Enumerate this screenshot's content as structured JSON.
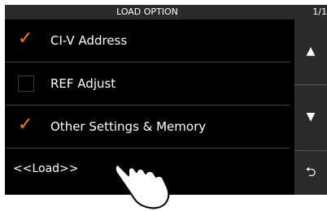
{
  "header": {
    "title": "LOAD OPTION",
    "page": "1/1"
  },
  "options": [
    {
      "label": "CI-V Address",
      "checked": true
    },
    {
      "label": "REF Adjust",
      "checked": false
    },
    {
      "label": "Other Settings & Memory",
      "checked": true
    }
  ],
  "check_glyph": "✓",
  "load_label": "<<Load>>",
  "buttons": {
    "up": {
      "glyph": "▲",
      "icon": "up-arrow-icon"
    },
    "down": {
      "glyph": "▼",
      "icon": "down-arrow-icon"
    },
    "back": {
      "glyph": "⮌",
      "icon": "return-icon"
    }
  },
  "colors": {
    "screen_bg": "#000000",
    "check": "#ff7a1a",
    "title_bg": "#2b2b2b",
    "button_bg": "#2a2a2a"
  }
}
